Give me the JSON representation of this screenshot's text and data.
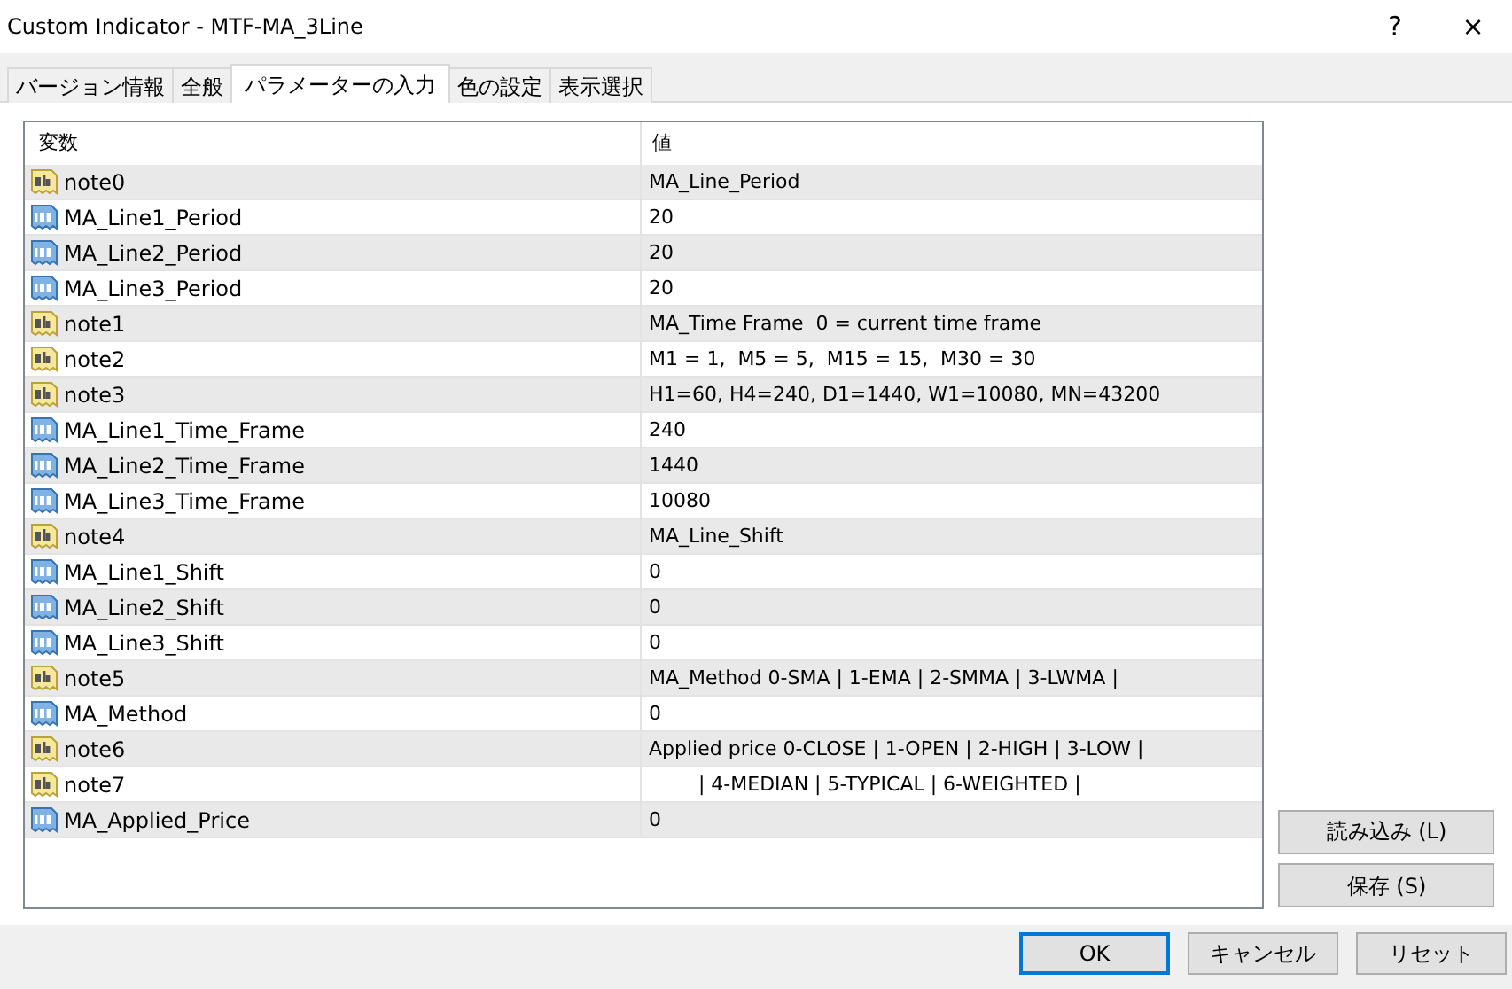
{
  "window": {
    "title": "Custom Indicator - MTF-MA_3Line",
    "help": "?",
    "close": "×"
  },
  "tabs": [
    {
      "label": "バージョン情報",
      "selected": false
    },
    {
      "label": "全般",
      "selected": false
    },
    {
      "label": "パラメーターの入力",
      "selected": true
    },
    {
      "label": "色の設定",
      "selected": false
    },
    {
      "label": "表示選択",
      "selected": false
    }
  ],
  "table": {
    "columns": [
      "変数",
      "値"
    ],
    "rows": [
      {
        "kind": "string",
        "name": "note0",
        "value": "MA_Line_Period"
      },
      {
        "kind": "number",
        "name": "MA_Line1_Period",
        "value": "20"
      },
      {
        "kind": "number",
        "name": "MA_Line2_Period",
        "value": "20"
      },
      {
        "kind": "number",
        "name": "MA_Line3_Period",
        "value": "20"
      },
      {
        "kind": "string",
        "name": "note1",
        "value": "MA_Time Frame  0 = current time frame"
      },
      {
        "kind": "string",
        "name": "note2",
        "value": "M1 = 1,  M5 = 5,  M15 = 15,  M30 = 30"
      },
      {
        "kind": "string",
        "name": "note3",
        "value": "H1=60, H4=240, D1=1440, W1=10080, MN=43200"
      },
      {
        "kind": "number",
        "name": "MA_Line1_Time_Frame",
        "value": "240"
      },
      {
        "kind": "number",
        "name": "MA_Line2_Time_Frame",
        "value": "1440"
      },
      {
        "kind": "number",
        "name": "MA_Line3_Time_Frame",
        "value": "10080"
      },
      {
        "kind": "string",
        "name": "note4",
        "value": "MA_Line_Shift"
      },
      {
        "kind": "number",
        "name": "MA_Line1_Shift",
        "value": "0"
      },
      {
        "kind": "number",
        "name": "MA_Line2_Shift",
        "value": "0"
      },
      {
        "kind": "number",
        "name": "MA_Line3_Shift",
        "value": "0"
      },
      {
        "kind": "string",
        "name": "note5",
        "value": "MA_Method 0-SMA | 1-EMA | 2-SMMA | 3-LWMA |"
      },
      {
        "kind": "number",
        "name": "MA_Method",
        "value": "0"
      },
      {
        "kind": "string",
        "name": "note6",
        "value": "Applied price 0-CLOSE | 1-OPEN | 2-HIGH | 3-LOW |"
      },
      {
        "kind": "string",
        "name": "note7",
        "value": "        | 4-MEDIAN | 5-TYPICAL | 6-WEIGHTED |"
      },
      {
        "kind": "number",
        "name": "MA_Applied_Price",
        "value": "0"
      }
    ]
  },
  "side_buttons": [
    "読み込み (L)",
    "保存 (S)"
  ],
  "buttons": [
    {
      "label": "OK",
      "default": true
    },
    {
      "label": "キャンセル",
      "default": false
    },
    {
      "label": "リセット",
      "default": false
    }
  ]
}
